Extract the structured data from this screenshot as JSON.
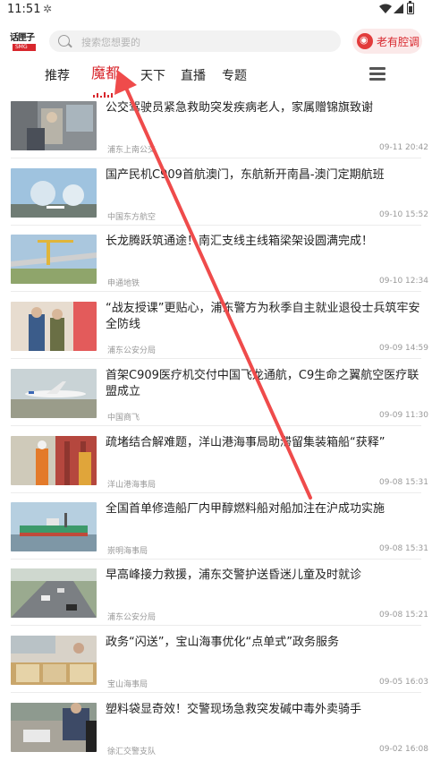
{
  "status_bar": {
    "time": "11:51"
  },
  "header": {
    "logo": {
      "name": "话匣子",
      "sub": "SMG"
    },
    "search_placeholder": "搜索您想要的",
    "dialect_button": "老有腔调"
  },
  "tabs": [
    {
      "label": "推荐",
      "active": false
    },
    {
      "label": "魔都",
      "active": true
    },
    {
      "label": "天下",
      "active": false
    },
    {
      "label": "直播",
      "active": false
    },
    {
      "label": "专题",
      "active": false
    }
  ],
  "news": [
    {
      "title": "公交驾驶员紧急救助突发疾病老人，家属赠锦旗致谢",
      "source": "浦东上南公交",
      "date": "09-11 20:42"
    },
    {
      "title": "国产民机C909首航澳门，东航新开南昌-澳门定期航班",
      "source": "中国东方航空",
      "date": "09-10 15:52"
    },
    {
      "title": "长龙腾跃筑通途！南汇支线主线箱梁架设圆满完成！",
      "source": "申通地铁",
      "date": "09-10 12:34"
    },
    {
      "title": "“战友授课”更贴心，浦东警方为秋季自主就业退役士兵筑牢安全防线",
      "source": "浦东公安分局",
      "date": "09-09 14:59"
    },
    {
      "title": "首架C909医疗机交付中国飞龙通航，C9生命之翼航空医疗联盟成立",
      "source": "中国商飞",
      "date": "09-09 11:30"
    },
    {
      "title": "疏堵结合解难题，洋山港海事局助滞留集装箱船“获释”",
      "source": "洋山港海事局",
      "date": "09-08 15:31"
    },
    {
      "title": "全国首单修造船厂内甲醇燃料船对船加注在沪成功实施",
      "source": "崇明海事局",
      "date": "09-08 15:31"
    },
    {
      "title": "早高峰接力救援，浦东交警护送昏迷儿童及时就诊",
      "source": "浦东公安分局",
      "date": "09-08 15:21"
    },
    {
      "title": "政务“闪送”，宝山海事优化“点单式”政务服务",
      "source": "宝山海事局",
      "date": "09-05 16:03"
    },
    {
      "title": "塑料袋显奇效！交警现场急救突发碱中毒外卖骑手",
      "source": "徐汇交警支队",
      "date": "09-02 16:08"
    }
  ],
  "colors": {
    "accent": "#d8272d",
    "annotation_arrow": "#ef4b4b"
  }
}
